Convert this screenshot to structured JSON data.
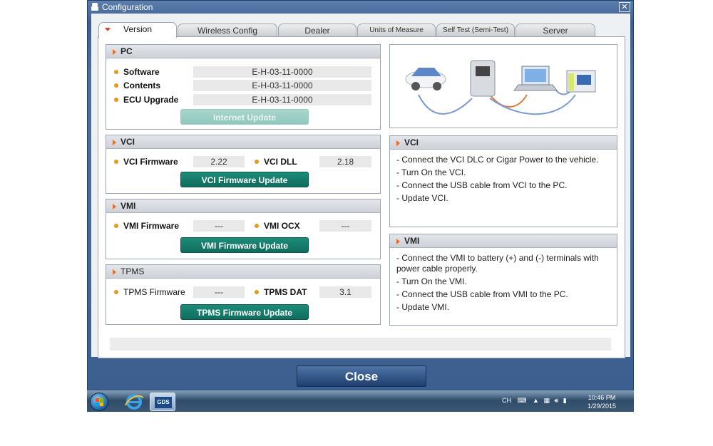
{
  "window": {
    "title": "Configuration",
    "close_glyph": "✕"
  },
  "tabs": [
    {
      "label": "Version",
      "active": true
    },
    {
      "label": "Wireless Config"
    },
    {
      "label": "Dealer"
    },
    {
      "label": "Units of Measure"
    },
    {
      "label": "Self Test (Semi-Test)"
    },
    {
      "label": "Server"
    }
  ],
  "pc": {
    "title": "PC",
    "software_label": "Software",
    "software_value": "E-H-03-11-0000",
    "contents_label": "Contents",
    "contents_value": "E-H-03-11-0000",
    "ecu_label": "ECU Upgrade",
    "ecu_value": "E-H-03-11-0000",
    "update_button": "Internet Update"
  },
  "vci": {
    "title": "VCI",
    "firmware_label": "VCI Firmware",
    "firmware_value": "2.22",
    "dll_label": "VCI DLL",
    "dll_value": "2.18",
    "update_button": "VCI Firmware Update"
  },
  "vmi": {
    "title": "VMI",
    "firmware_label": "VMI Firmware",
    "firmware_value": "---",
    "ocx_label": "VMI OCX",
    "ocx_value": "---",
    "update_button": "VMI Firmware Update"
  },
  "tpms": {
    "title": "TPMS",
    "firmware_label": "TPMS Firmware",
    "firmware_value": "---",
    "dat_label": "TPMS DAT",
    "dat_value": "3.1",
    "update_button": "TPMS Firmware Update"
  },
  "vci_info": {
    "title": "VCI",
    "lines": [
      "- Connect the VCI DLC or Cigar Power to the vehicle.",
      "- Turn On the VCI.",
      "- Connect the USB cable from VCI to the PC.",
      "- Update VCI."
    ]
  },
  "vmi_info": {
    "title": "VMI",
    "lines": [
      "- Connect the VMI to battery (+) and (-) terminals with power cable properly.",
      "- Turn On the VMI.",
      "- Connect the USB cable from VMI to the PC.",
      "- Update VMI."
    ]
  },
  "close_button": "Close",
  "taskbar": {
    "gds_label": "GDS",
    "language": "CH",
    "time": "10:46 PM",
    "date": "1/29/2015"
  },
  "colors": {
    "accent_green": "#0f6d5e",
    "title_blue": "#3f5f8f",
    "bullet_orange": "#e39a1a"
  }
}
